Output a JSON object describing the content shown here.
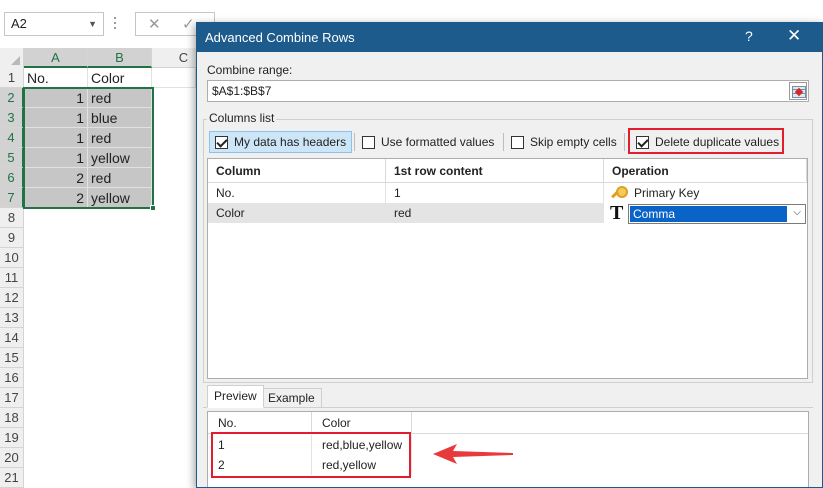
{
  "excel": {
    "name_box": "A2",
    "formula_cancel_icon": "✕",
    "formula_enter_icon": "✓",
    "columns": [
      "A",
      "B",
      "C"
    ],
    "rows": [
      "1",
      "2",
      "3",
      "4",
      "5",
      "6",
      "7",
      "8",
      "9",
      "10",
      "11",
      "12",
      "13",
      "14",
      "15",
      "16",
      "17",
      "18",
      "19",
      "20",
      "21"
    ],
    "data": [
      [
        "No.",
        "Color"
      ],
      [
        "1",
        "red"
      ],
      [
        "1",
        "blue"
      ],
      [
        "1",
        "red"
      ],
      [
        "1",
        "yellow"
      ],
      [
        "2",
        "red"
      ],
      [
        "2",
        "yellow"
      ]
    ],
    "accent_color": "#217346"
  },
  "dialog": {
    "title": "Advanced Combine Rows",
    "help_label": "?",
    "close_label": "✕",
    "titlebar_color": "#1d5b8c",
    "combine_range_label": "Combine range:",
    "combine_range_value": "$A$1:$B$7",
    "columns_list_label": "Columns list",
    "options": [
      {
        "label": "My data has headers",
        "checked": true
      },
      {
        "label": "Use formatted values",
        "checked": false
      },
      {
        "label": "Skip empty cells",
        "checked": false
      },
      {
        "label": "Delete duplicate values",
        "checked": true
      }
    ],
    "table": {
      "headers": [
        "Column",
        "1st row content",
        "Operation"
      ],
      "rows": [
        {
          "column": "No.",
          "first": "1",
          "operation": "Primary Key",
          "icon": "key-icon"
        },
        {
          "column": "Color",
          "first": "red",
          "operation": "Comma",
          "icon": "text-icon"
        }
      ]
    },
    "tabs": [
      "Preview",
      "Example"
    ],
    "preview": {
      "headers": [
        "No.",
        "Color"
      ],
      "rows": [
        [
          "1",
          "red,blue,yellow"
        ],
        [
          "2",
          "red,yellow"
        ]
      ]
    },
    "highlight_color": "#e21d2d"
  }
}
